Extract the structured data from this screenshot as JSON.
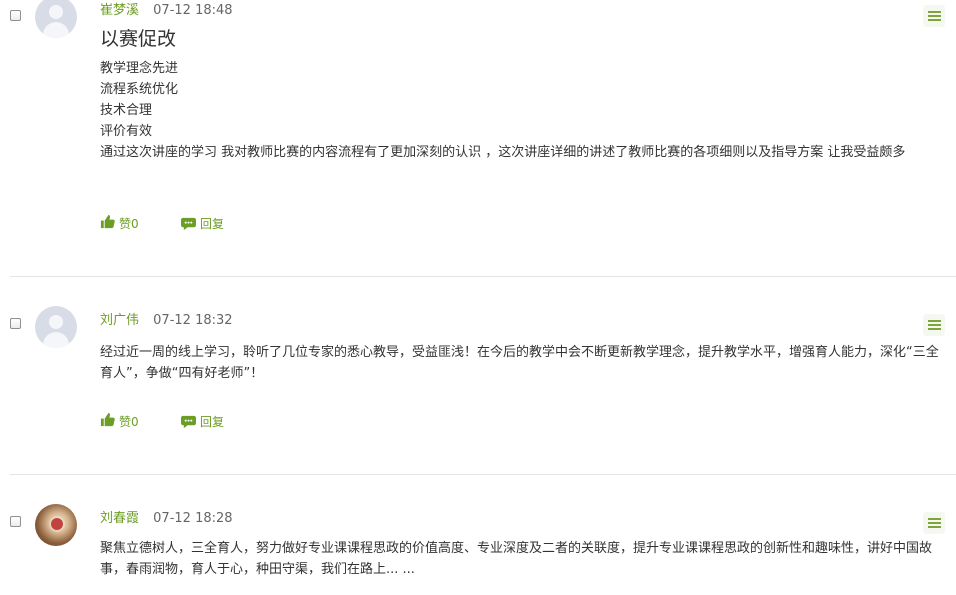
{
  "comments": [
    {
      "author": "崔梦溪",
      "time": "07-12 18:48",
      "title": "以赛促改",
      "paragraphs": [
        "教学理念先进",
        "流程系统优化",
        "技术合理",
        "评价有效",
        "通过这次讲座的学习 我对教师比赛的内容流程有了更加深刻的认识 ，这次讲座详细的讲述了教师比赛的各项细则以及指导方案 让我受益颇多"
      ],
      "like_label": "赞0",
      "reply_label": "回复",
      "avatar": "default-avatar-icon"
    },
    {
      "author": "刘广伟",
      "time": "07-12 18:32",
      "paragraphs": [
        "经过近一周的线上学习，聆听了几位专家的悉心教导，受益匪浅！在今后的教学中会不断更新教学理念，提升教学水平，增强育人能力，深化“三全育人”，争做“四有好老师”！"
      ],
      "like_label": "赞0",
      "reply_label": "回复",
      "avatar": "default-avatar-icon"
    },
    {
      "author": "刘春霞",
      "time": "07-12 18:28",
      "paragraphs": [
        "聚焦立德树人，三全育人，努力做好专业课课程思政的价值高度、专业深度及二者的关联度，提升专业课课程思政的创新性和趣味性，讲好中国故事，春雨润物，育人于心，种田守渠，我们在路上... ..."
      ],
      "avatar": "user-photo-avatar"
    }
  ],
  "icons": {
    "menu": "hamburger-menu-icon",
    "like": "thumbs-up-icon",
    "reply": "comment-bubble-icon",
    "checkbox": "checkbox-icon"
  },
  "colors": {
    "accent": "#6c9d24",
    "text": "#333333",
    "muted": "#666666",
    "divider": "#e4e4e4"
  }
}
